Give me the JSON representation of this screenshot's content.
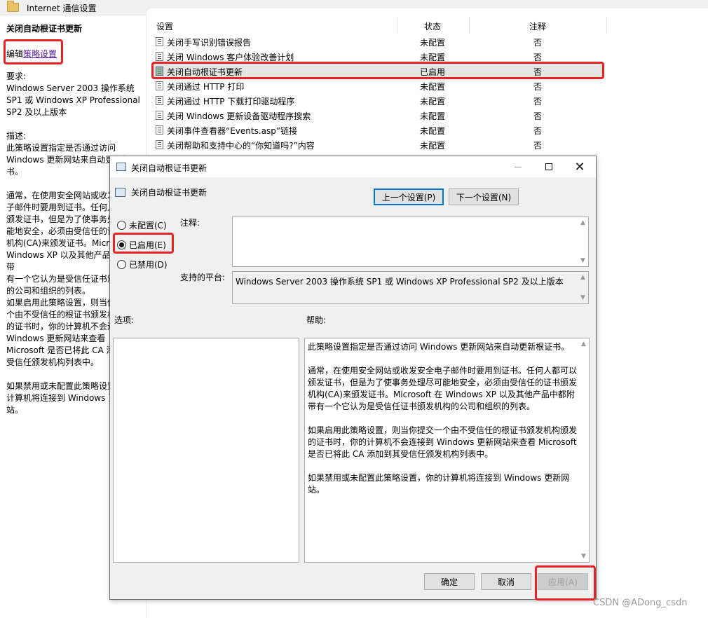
{
  "window": {
    "title": "Internet 通信设置",
    "folder_icon": "folder-icon"
  },
  "left_pane": {
    "title": "关闭自动根证书更新",
    "edit_prefix": "编辑",
    "edit_link": "策略设置",
    "requirements_label": "要求:",
    "requirements_text": "Windows Server 2003 操作系统\nSP1 或 Windows XP Professional\nSP2 及以上版本",
    "description_label": "描述:",
    "desc_p1": "此策略设置指定是否通过访问\nWindows 更新网站来自动更新根证\n书。",
    "desc_p2": "通常，在使用安全网站或收发安全电\n子邮件时要用到证书。任何人都可以\n颁发证书，但是为了使事务处理尽可\n能地安全，必须由受信任的证书颁发\n机构(CA)来颁发证书。Microsoft 在\nWindows XP 以及其他产品中都附带\n有一个它认为是受信任证书颁发机构\n的公司和组织的列表。",
    "desc_p3": "如果启用此策略设置，则当你提交一\n个由不受信任的根证书颁发机构颁发\n的证书时，你的计算机不会连接到\nWindows 更新网站来查看\nMicrosoft 是否已将此 CA 添加到其\n受信任颁发机构列表中。",
    "desc_p4": "如果禁用或未配置此策略设置，你的\n计算机将连接到 Windows 更新网\n站。"
  },
  "policy_list": {
    "headers": {
      "setting": "设置",
      "state": "状态",
      "note": "注释"
    },
    "rows": [
      {
        "name": "关闭手写识别错误报告",
        "state": "未配置",
        "note": "否"
      },
      {
        "name": "关闭 Windows 客户体验改善计划",
        "state": "未配置",
        "note": "否"
      },
      {
        "name": "关闭自动根证书更新",
        "state": "已启用",
        "note": "否"
      },
      {
        "name": "关闭通过 HTTP 打印",
        "state": "未配置",
        "note": "否"
      },
      {
        "name": "关闭通过 HTTP 下载打印驱动程序",
        "state": "未配置",
        "note": "否"
      },
      {
        "name": "关闭 Windows 更新设备驱动程序搜索",
        "state": "未配置",
        "note": "否"
      },
      {
        "name": "关闭事件查看器“Events.asp”链接",
        "state": "未配置",
        "note": "否"
      },
      {
        "name": "关闭帮助和支持中心的“你知道吗?”内容",
        "state": "未配置",
        "note": "否"
      }
    ]
  },
  "dialog": {
    "title": "关闭自动根证书更新",
    "subtitle": "关闭自动根证书更新",
    "prev_button": "上一个设置(P)",
    "next_button": "下一个设置(N)",
    "radios": [
      {
        "label": "未配置(C)",
        "checked": false
      },
      {
        "label": "已启用(E)",
        "checked": true
      },
      {
        "label": "已禁用(D)",
        "checked": false
      }
    ],
    "comment_label": "注释:",
    "comment_value": "",
    "platform_label": "支持的平台:",
    "platform_value": "Windows Server 2003 操作系统 SP1 或 Windows XP Professional SP2 及以上版本",
    "options_label": "选项:",
    "help_label": "帮助:",
    "help_text": "此策略设置指定是否通过访问 Windows 更新网站来自动更新根证书。\n\n通常，在使用安全网站或收发安全电子邮件时要用到证书。任何人都可以颁发证书，但是为了使事务处理尽可能地安全，必须由受信任的证书颁发机构(CA)来颁发证书。Microsoft 在 Windows XP 以及其他产品中都附带有一个它认为是受信任证书颁发机构的公司和组织的列表。\n\n如果启用此策略设置，则当你提交一个由不受信任的根证书颁发机构颁发的证书时，你的计算机不会连接到 Windows 更新网站来查看 Microsoft 是否已将此 CA 添加到其受信任颁发机构列表中。\n\n如果禁用或未配置此策略设置，你的计算机将连接到 Windows 更新网站。",
    "ok_button": "确定",
    "cancel_button": "取消",
    "apply_button": "应用(A)"
  },
  "watermark": "CSDN @ADong_csdn",
  "colors": {
    "annotation": "#e52424",
    "link": "#5a1a99",
    "default_button_border": "#0078d7"
  }
}
